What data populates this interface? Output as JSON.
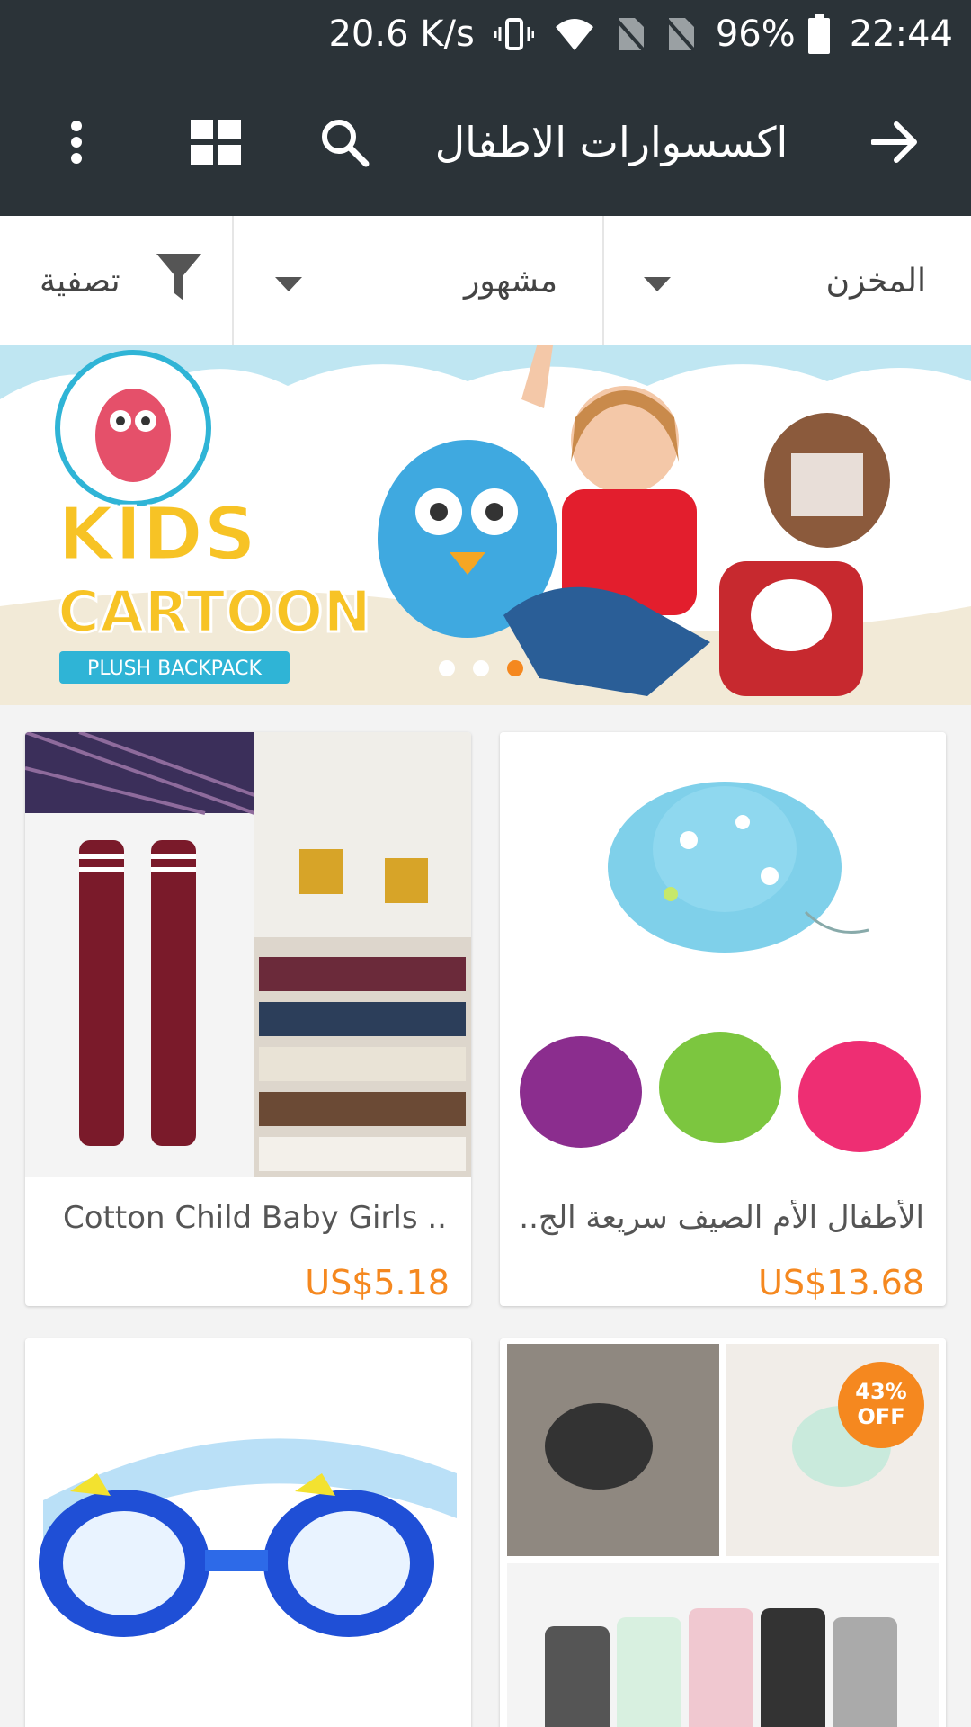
{
  "status_bar": {
    "network_speed": "20.6 K/s",
    "battery_percent": "96%",
    "time": "22:44",
    "icons": [
      "vibrate-icon",
      "wifi-icon",
      "no-sim-icon",
      "no-sim-icon",
      "battery-icon"
    ]
  },
  "app_bar": {
    "title": "اكسسوارات الاطفال",
    "icons": [
      "back-arrow-icon",
      "search-icon",
      "grid-view-icon",
      "more-vert-icon"
    ]
  },
  "filters": {
    "warehouse_label": "المخزن",
    "sort_label": "مشهور",
    "filter_label": "تصفية"
  },
  "banner": {
    "headline_line1": "KIDS",
    "headline_line2": "CARTOON",
    "tag": "PLUSH BACKPACK",
    "slide_count": 3,
    "active_slide": 3
  },
  "products": [
    {
      "name": "الأطفال الأم الصيف سريعة الج...",
      "price": "US$13.68",
      "image": "kids-sun-hats"
    },
    {
      "name": "Cotton Child Baby Girls ...",
      "price": "US$5.18",
      "image": "knee-high-socks"
    },
    {
      "name": "",
      "price": "",
      "image": "baby-knee-pads",
      "badge_pct": "43%",
      "badge_off": "OFF"
    },
    {
      "name": "",
      "price": "",
      "image": "kids-swim-goggles"
    }
  ],
  "colors": {
    "toolbar": "#2b3338",
    "price": "#f5881f",
    "badge": "#f5881f"
  }
}
